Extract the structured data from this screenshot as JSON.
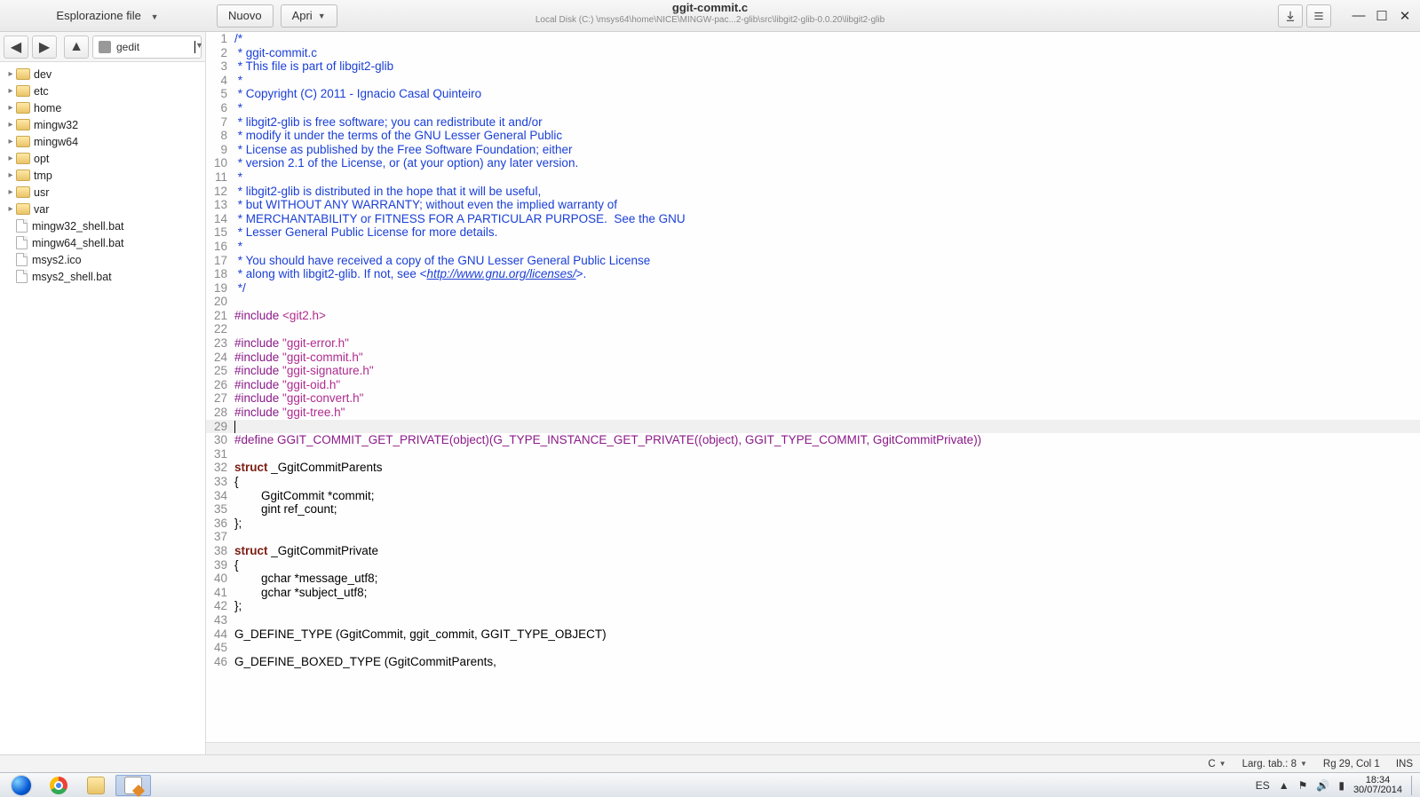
{
  "header": {
    "explorer_label": "Esplorazione file",
    "btn_new": "Nuovo",
    "btn_open": "Apri",
    "title": "ggit-commit.c",
    "path": "Local Disk (C:) \\msys64\\home\\NICE\\MINGW-pac...2-glib\\src\\libgit2-glib-0.0.20\\libgit2-glib"
  },
  "sidebar": {
    "location": "gedit",
    "folders": [
      "dev",
      "etc",
      "home",
      "mingw32",
      "mingw64",
      "opt",
      "tmp",
      "usr",
      "var"
    ],
    "files": [
      "mingw32_shell.bat",
      "mingw64_shell.bat",
      "msys2.ico",
      "msys2_shell.bat"
    ]
  },
  "editor": {
    "current_line_index": 28,
    "lines": [
      {
        "n": 1,
        "spans": [
          {
            "cls": "c-comment",
            "t": "/*"
          }
        ]
      },
      {
        "n": 2,
        "spans": [
          {
            "cls": "c-comment",
            "t": " * ggit-commit.c"
          }
        ]
      },
      {
        "n": 3,
        "spans": [
          {
            "cls": "c-comment",
            "t": " * This file is part of libgit2-glib"
          }
        ]
      },
      {
        "n": 4,
        "spans": [
          {
            "cls": "c-comment",
            "t": " *"
          }
        ]
      },
      {
        "n": 5,
        "spans": [
          {
            "cls": "c-comment",
            "t": " * Copyright (C) 2011 - Ignacio Casal Quinteiro"
          }
        ]
      },
      {
        "n": 6,
        "spans": [
          {
            "cls": "c-comment",
            "t": " *"
          }
        ]
      },
      {
        "n": 7,
        "spans": [
          {
            "cls": "c-comment",
            "t": " * libgit2-glib is free software; you can redistribute it and/or"
          }
        ]
      },
      {
        "n": 8,
        "spans": [
          {
            "cls": "c-comment",
            "t": " * modify it under the terms of the GNU Lesser General Public"
          }
        ]
      },
      {
        "n": 9,
        "spans": [
          {
            "cls": "c-comment",
            "t": " * License as published by the Free Software Foundation; either"
          }
        ]
      },
      {
        "n": 10,
        "spans": [
          {
            "cls": "c-comment",
            "t": " * version 2.1 of the License, or (at your option) any later version."
          }
        ]
      },
      {
        "n": 11,
        "spans": [
          {
            "cls": "c-comment",
            "t": " *"
          }
        ]
      },
      {
        "n": 12,
        "spans": [
          {
            "cls": "c-comment",
            "t": " * libgit2-glib is distributed in the hope that it will be useful,"
          }
        ]
      },
      {
        "n": 13,
        "spans": [
          {
            "cls": "c-comment",
            "t": " * but WITHOUT ANY WARRANTY; without even the implied warranty of"
          }
        ]
      },
      {
        "n": 14,
        "spans": [
          {
            "cls": "c-comment",
            "t": " * MERCHANTABILITY or FITNESS FOR A PARTICULAR PURPOSE.  See the GNU"
          }
        ]
      },
      {
        "n": 15,
        "spans": [
          {
            "cls": "c-comment",
            "t": " * Lesser General Public License for more details."
          }
        ]
      },
      {
        "n": 16,
        "spans": [
          {
            "cls": "c-comment",
            "t": " *"
          }
        ]
      },
      {
        "n": 17,
        "spans": [
          {
            "cls": "c-comment",
            "t": " * You should have received a copy of the GNU Lesser General Public License"
          }
        ]
      },
      {
        "n": 18,
        "spans": [
          {
            "cls": "c-comment",
            "t": " * along with libgit2-glib. If not, see <"
          },
          {
            "cls": "c-url",
            "t": "http://www.gnu.org/licenses/"
          },
          {
            "cls": "c-comment",
            "t": ">."
          }
        ]
      },
      {
        "n": 19,
        "spans": [
          {
            "cls": "c-comment",
            "t": " */"
          }
        ]
      },
      {
        "n": 20,
        "spans": [
          {
            "cls": "c-plain",
            "t": ""
          }
        ]
      },
      {
        "n": 21,
        "spans": [
          {
            "cls": "c-pre",
            "t": "#include "
          },
          {
            "cls": "c-str",
            "t": "<git2.h>"
          }
        ]
      },
      {
        "n": 22,
        "spans": [
          {
            "cls": "c-plain",
            "t": ""
          }
        ]
      },
      {
        "n": 23,
        "spans": [
          {
            "cls": "c-pre",
            "t": "#include "
          },
          {
            "cls": "c-str",
            "t": "\"ggit-error.h\""
          }
        ]
      },
      {
        "n": 24,
        "spans": [
          {
            "cls": "c-pre",
            "t": "#include "
          },
          {
            "cls": "c-str",
            "t": "\"ggit-commit.h\""
          }
        ]
      },
      {
        "n": 25,
        "spans": [
          {
            "cls": "c-pre",
            "t": "#include "
          },
          {
            "cls": "c-str",
            "t": "\"ggit-signature.h\""
          }
        ]
      },
      {
        "n": 26,
        "spans": [
          {
            "cls": "c-pre",
            "t": "#include "
          },
          {
            "cls": "c-str",
            "t": "\"ggit-oid.h\""
          }
        ]
      },
      {
        "n": 27,
        "spans": [
          {
            "cls": "c-pre",
            "t": "#include "
          },
          {
            "cls": "c-str",
            "t": "\"ggit-convert.h\""
          }
        ]
      },
      {
        "n": 28,
        "spans": [
          {
            "cls": "c-pre",
            "t": "#include "
          },
          {
            "cls": "c-str",
            "t": "\"ggit-tree.h\""
          }
        ]
      },
      {
        "n": 29,
        "spans": [
          {
            "cls": "c-plain",
            "t": ""
          }
        ]
      },
      {
        "n": 30,
        "spans": [
          {
            "cls": "c-pre",
            "t": "#define GGIT_COMMIT_GET_PRIVATE(object)(G_TYPE_INSTANCE_GET_PRIVATE((object), GGIT_TYPE_COMMIT, GgitCommitPrivate))"
          }
        ]
      },
      {
        "n": 31,
        "spans": [
          {
            "cls": "c-plain",
            "t": ""
          }
        ]
      },
      {
        "n": 32,
        "spans": [
          {
            "cls": "c-kw",
            "t": "struct"
          },
          {
            "cls": "c-plain",
            "t": " _GgitCommitParents"
          }
        ]
      },
      {
        "n": 33,
        "spans": [
          {
            "cls": "c-plain",
            "t": "{"
          }
        ]
      },
      {
        "n": 34,
        "spans": [
          {
            "cls": "c-plain",
            "t": "        GgitCommit *commit;"
          }
        ]
      },
      {
        "n": 35,
        "spans": [
          {
            "cls": "c-plain",
            "t": "        gint ref_count;"
          }
        ]
      },
      {
        "n": 36,
        "spans": [
          {
            "cls": "c-plain",
            "t": "};"
          }
        ]
      },
      {
        "n": 37,
        "spans": [
          {
            "cls": "c-plain",
            "t": ""
          }
        ]
      },
      {
        "n": 38,
        "spans": [
          {
            "cls": "c-kw",
            "t": "struct"
          },
          {
            "cls": "c-plain",
            "t": " _GgitCommitPrivate"
          }
        ]
      },
      {
        "n": 39,
        "spans": [
          {
            "cls": "c-plain",
            "t": "{"
          }
        ]
      },
      {
        "n": 40,
        "spans": [
          {
            "cls": "c-plain",
            "t": "        gchar *message_utf8;"
          }
        ]
      },
      {
        "n": 41,
        "spans": [
          {
            "cls": "c-plain",
            "t": "        gchar *subject_utf8;"
          }
        ]
      },
      {
        "n": 42,
        "spans": [
          {
            "cls": "c-plain",
            "t": "};"
          }
        ]
      },
      {
        "n": 43,
        "spans": [
          {
            "cls": "c-plain",
            "t": ""
          }
        ]
      },
      {
        "n": 44,
        "spans": [
          {
            "cls": "c-plain",
            "t": "G_DEFINE_TYPE (GgitCommit, ggit_commit, GGIT_TYPE_OBJECT)"
          }
        ]
      },
      {
        "n": 45,
        "spans": [
          {
            "cls": "c-plain",
            "t": ""
          }
        ]
      },
      {
        "n": 46,
        "spans": [
          {
            "cls": "c-plain",
            "t": "G_DEFINE_BOXED_TYPE (GgitCommitParents,"
          }
        ]
      }
    ]
  },
  "status": {
    "lang": "C",
    "tab": "Larg. tab.: 8",
    "pos": "Rg 29, Col 1",
    "ins": "INS"
  },
  "taskbar": {
    "lang": "ES",
    "time": "18:34",
    "date": "30/07/2014"
  }
}
